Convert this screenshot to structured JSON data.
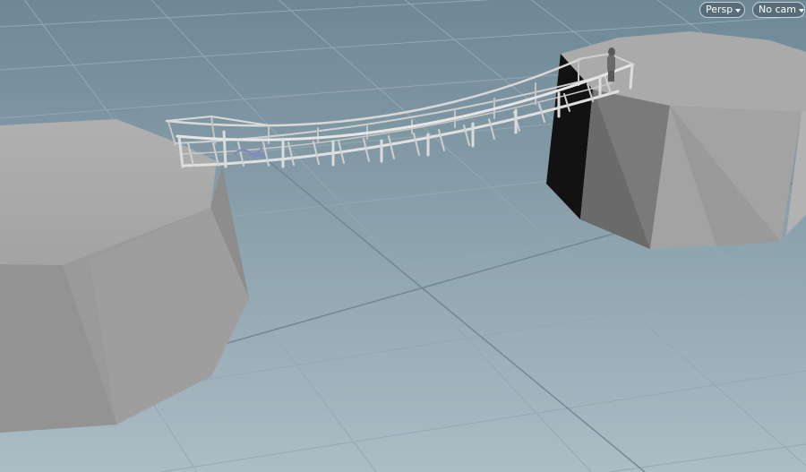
{
  "viewport": {
    "view_menu_label": "Persp",
    "camera_menu_label": "No cam",
    "view_menu_icon": "chevron-down-icon",
    "camera_menu_icon": "chevron-down-icon"
  },
  "scene": {
    "objects": [
      "left-cliff",
      "right-cliff",
      "rope-bridge",
      "figure"
    ],
    "colors": {
      "background_top": "#6e8896",
      "background_bottom": "#a9bcc4",
      "grid_line": "#8ea3ae",
      "grid_major": "#7a8f9a",
      "cliff_top": "#a9a9a9",
      "cliff_side_light": "#8c8c8c",
      "cliff_side_dark": "#666666",
      "cliff_shadow": "#111111",
      "bridge": "#d2d2d2",
      "bridge_shade": "#8a8a8a"
    }
  }
}
